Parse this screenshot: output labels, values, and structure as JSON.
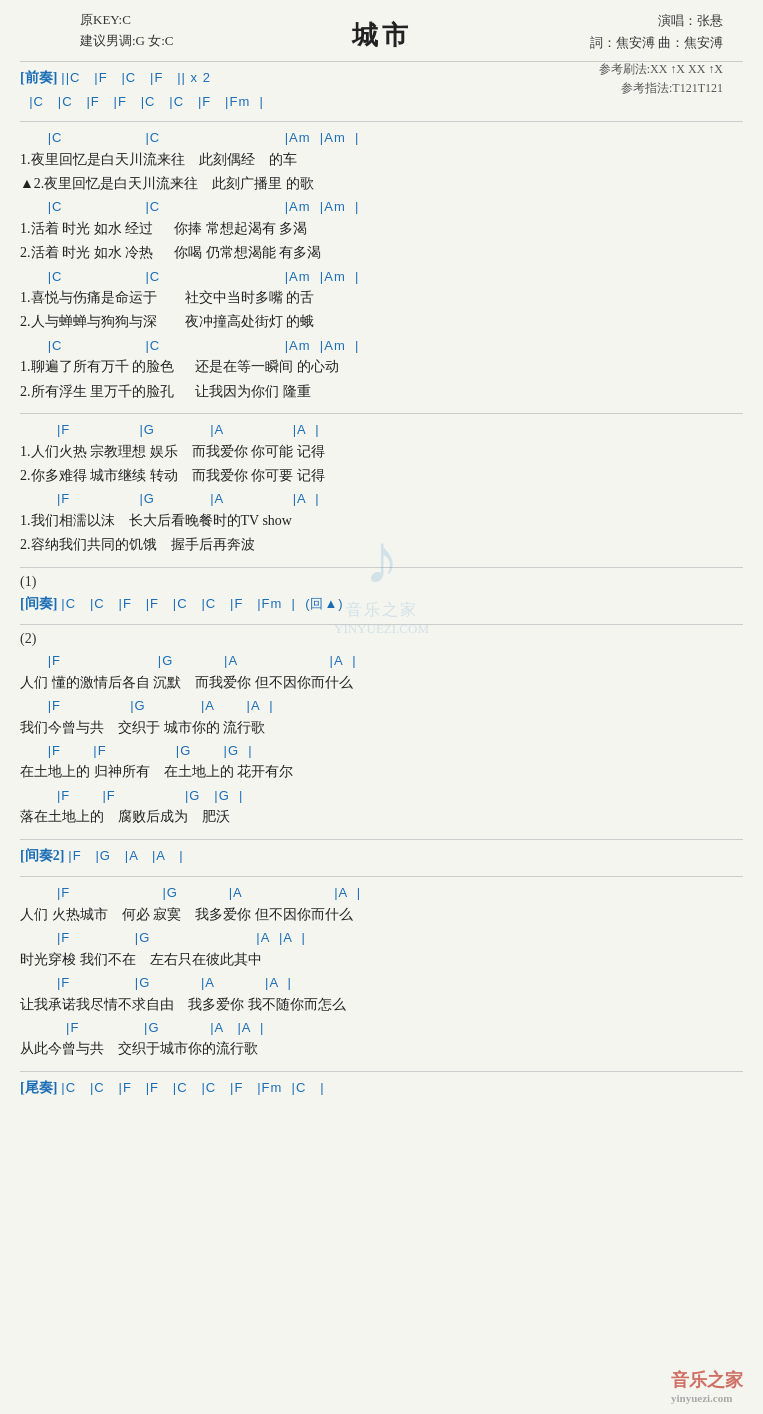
{
  "header": {
    "title": "城市",
    "key_original": "原KEY:C",
    "key_suggest": "建议男调:G 女:C",
    "artist_label": "演唱：张悬",
    "lyricist_label": "詞：焦安溥  曲：焦安溥",
    "ref_strum": "参考刷法:XX ↑X XX ↑X",
    "ref_pick": "参考指法:T121T121"
  },
  "sections": {
    "prelude_label": "[前奏]",
    "prelude_chords1": "||C   |F   |C   |F   || x 2",
    "prelude_chords2": "  |C   |C   |F   |F   |C   |C   |F   |Fm  |",
    "verse1_chords1": "      |C                  |C                           |Am  |Am  |",
    "verse1_lyric1a": "1.夜里回忆是白天川流来往    此刻偶经    的车",
    "verse1_lyric1b": "▲2.夜里回忆是白天川流来往    此刻广播里 的歌",
    "verse1_chords2": "      |C                  |C                           |Am  |Am  |",
    "verse1_lyric2a": "1.活着 时光 如水 经过      你捧 常想起渴有 多渴",
    "verse1_lyric2b": "2.活着 时光 如水 冷热      你喝 仍常想渴能 有多渴",
    "verse1_chords3": "      |C                  |C                           |Am  |Am  |",
    "verse1_lyric3a": "1.喜悦与伤痛是命运于        社交中当时多嘴 的舌",
    "verse1_lyric3b": "2.人与蝉蝉与狗狗与深        夜冲撞高处街灯 的蛾",
    "verse1_chords4": "      |C                  |C                           |Am  |Am  |",
    "verse1_lyric4a": "1.聊遍了所有万千 的脸色      还是在等一瞬间 的心动",
    "verse1_lyric4b": "2.所有浮生 里万千的脸孔      让我因为你们 隆重",
    "chorus1_chords1": "        |F               |G            |A               |A  |",
    "chorus1_lyric1a": "1.人们火热 宗教理想 娱乐    而我爱你 你可能 记得",
    "chorus1_lyric1b": "2.你多难得 城市继续 转动    而我爱你 你可要 记得",
    "chorus1_chords2": "        |F               |G            |A               |A  |",
    "chorus1_lyric2a": "1.我们相濡以沫    长大后看晚餐时的TV show",
    "chorus1_lyric2b": "2.容纳我们共同的饥饿    握手后再奔波",
    "interlude1_num": "(1)",
    "interlude1_label": "[间奏]",
    "interlude1_chords": "|C   |C   |F   |F   |C   |C   |F   |Fm  |  (回▲)",
    "verse2_num": "(2)",
    "verse2_chords1": "      |F                     |G           |A                    |A  |",
    "verse2_lyric1": "人们 懂的激情后各自 沉默    而我爱你 但不因你而什么",
    "verse2_chords2": "      |F               |G            |A       |A  |",
    "verse2_lyric2": "我们今曾与共    交织于 城市你的 流行歌",
    "verse2_chords3": "      |F       |F               |G       |G  |",
    "verse2_lyric3": "在土地上的 归神所有    在土地上的 花开有尔",
    "verse2_chords4": "        |F       |F               |G   |G  |",
    "verse2_lyric4": "落在土地上的    腐败后成为    肥沃",
    "interlude2_label": "[间奏2]",
    "interlude2_chords": "|F   |G   |A   |A   |",
    "bridge_chords1": "        |F                    |G           |A                    |A  |",
    "bridge_lyric1": "人们 火热城市    何必 寂寞    我多爱你 但不因你而什么",
    "bridge_chords2": "        |F              |G                       |A  |A  |",
    "bridge_lyric2": "时光穿梭 我们不在    左右只在彼此其中",
    "bridge_chords3": "        |F              |G           |A           |A  |",
    "bridge_lyric3": "让我承诺我尽情不求自由    我多爱你 我不随你而怎么",
    "bridge_chords4": "          |F              |G           |A   |A  |",
    "bridge_lyric4": "从此今曾与共    交织于城市你的流行歌",
    "outro_label": "[尾奏]",
    "outro_chords": "|C   |C   |F   |F   |C   |C   |F   |Fm  |C   |"
  },
  "watermark": {
    "icon": "♪",
    "text": "音乐之家",
    "url": "YINYUEZI.COM"
  },
  "bottom_logo": "音乐之家",
  "bottom_logo_sub": "yinyuezi.com"
}
